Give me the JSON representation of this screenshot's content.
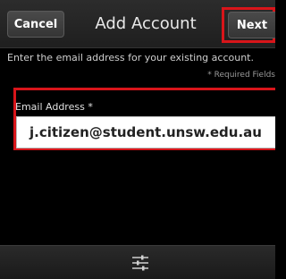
{
  "header": {
    "cancel_label": "Cancel",
    "title": "Add Account",
    "next_label": "Next"
  },
  "instruction": "Enter the email address for your existing account.",
  "required_note": "* Required Fields",
  "email_field": {
    "label": "Email Address *",
    "value": "j.citizen@student.unsw.edu.au"
  },
  "bottom_bar": {
    "icon": "settings-sliders-icon"
  },
  "colors": {
    "highlight": "#d8151a",
    "background": "#000000",
    "bar": "#222222"
  }
}
